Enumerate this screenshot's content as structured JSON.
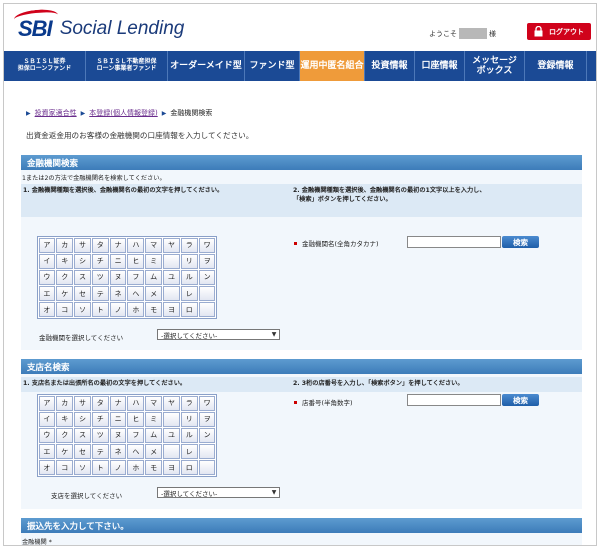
{
  "header": {
    "logo_mark": "SBI",
    "logo_text": "Social Lending",
    "welcome_prefix": "ようこそ",
    "welcome_suffix": "様",
    "logout_label": "ログアウト"
  },
  "nav": {
    "items": [
      {
        "label": "ＳＢＩＳＬ証券\n担保ローンファンド"
      },
      {
        "label": "ＳＢＩＳＬ不動産担保\nローン事業者ファンド"
      },
      {
        "label": "オーダーメイド型"
      },
      {
        "label": "ファンド型"
      },
      {
        "label": "運用中匿名組合"
      },
      {
        "label": "投資情報"
      },
      {
        "label": "口座情報"
      },
      {
        "label": "メッセージ\nボックス"
      },
      {
        "label": "登録情報"
      }
    ],
    "active_index": 4,
    "colors": {
      "bar": "#1b4a95",
      "active": "#ef9b3a"
    }
  },
  "breadcrumb": {
    "items": [
      "投資家適合性",
      "本登録(個人情報登録)",
      "金融機関検索"
    ]
  },
  "intro": "出資金返金用のお客様の金融機関の口座情報を入力してください。",
  "bank_section": {
    "title": "金融機関検索",
    "note": "1または2の方法で金融機関名を検索してください。",
    "col1_head": "1. 金融機関種類を選択後、金融機関名の最初の文字を押してください。",
    "col2_head_line1": "2. 金融機関種類を選択後、金融機関名の最初の1文字以上を入力し、",
    "col2_head_line2": "「検索」ボタンを押してください。",
    "kana_rows": [
      [
        "ア",
        "カ",
        "サ",
        "タ",
        "ナ",
        "ハ",
        "マ",
        "ヤ",
        "ラ",
        "ワ"
      ],
      [
        "イ",
        "キ",
        "シ",
        "チ",
        "ニ",
        "ヒ",
        "ミ",
        "",
        "リ",
        "ヲ"
      ],
      [
        "ウ",
        "ク",
        "ス",
        "ツ",
        "ヌ",
        "フ",
        "ム",
        "ユ",
        "ル",
        "ン"
      ],
      [
        "エ",
        "ケ",
        "セ",
        "テ",
        "ネ",
        "ヘ",
        "メ",
        "",
        "レ",
        ""
      ],
      [
        "オ",
        "コ",
        "ソ",
        "ト",
        "ノ",
        "ホ",
        "モ",
        "ヨ",
        "ロ",
        ""
      ]
    ],
    "select_label": "金融機関を選択してください",
    "select_value": "-選択してください-",
    "field_label": "金融機関名(全角カタカナ)",
    "search_label": "検索"
  },
  "branch_section": {
    "title": "支店名検索",
    "col1_head": "1. 支店名または出張所名の最初の文字を押してください。",
    "col2_head": "2. 3桁の店番号を入力し、「検索ボタン」を押してください。",
    "kana_rows": [
      [
        "ア",
        "カ",
        "サ",
        "タ",
        "ナ",
        "ハ",
        "マ",
        "ヤ",
        "ラ",
        "ワ"
      ],
      [
        "イ",
        "キ",
        "シ",
        "チ",
        "ニ",
        "ヒ",
        "ミ",
        "",
        "リ",
        "ヲ"
      ],
      [
        "ウ",
        "ク",
        "ス",
        "ツ",
        "ヌ",
        "フ",
        "ム",
        "ユ",
        "ル",
        "ン"
      ],
      [
        "エ",
        "ケ",
        "セ",
        "テ",
        "ネ",
        "ヘ",
        "メ",
        "",
        "レ",
        ""
      ],
      [
        "オ",
        "コ",
        "ソ",
        "ト",
        "ノ",
        "ホ",
        "モ",
        "ヨ",
        "ロ",
        ""
      ]
    ],
    "select_label": "支店を選択してください",
    "select_value": "-選択してください-",
    "field_label": "店番号(半角数字)",
    "search_label": "検索"
  },
  "transfer_section": {
    "title": "振込先を入力して下さい。",
    "first_label": "金融機関 *"
  }
}
